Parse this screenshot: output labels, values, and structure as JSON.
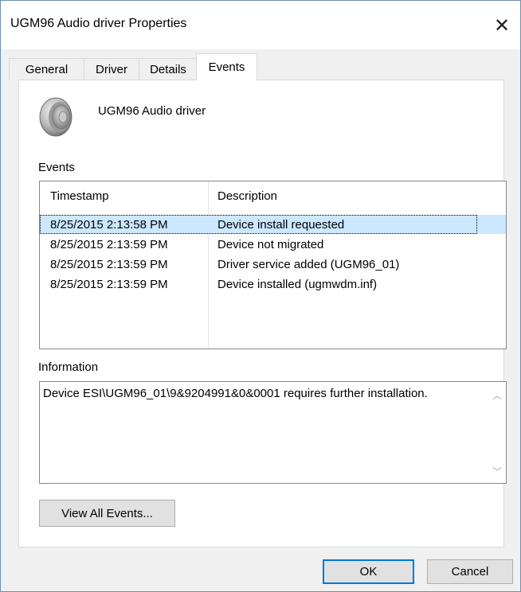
{
  "window": {
    "title": "UGM96 Audio driver Properties",
    "close_glyph": "✕"
  },
  "tabs": [
    {
      "label": "General",
      "active": false
    },
    {
      "label": "Driver",
      "active": false
    },
    {
      "label": "Details",
      "active": false
    },
    {
      "label": "Events",
      "active": true
    }
  ],
  "device": {
    "icon": "speaker-icon",
    "name": "UGM96 Audio driver"
  },
  "events": {
    "section_label": "Events",
    "columns": [
      "Timestamp",
      "Description"
    ],
    "rows": [
      {
        "timestamp": "8/25/2015 2:13:58 PM",
        "description": "Device install requested",
        "selected": true
      },
      {
        "timestamp": "8/25/2015 2:13:59 PM",
        "description": "Device not migrated",
        "selected": false
      },
      {
        "timestamp": "8/25/2015 2:13:59 PM",
        "description": "Driver service added (UGM96_01)",
        "selected": false
      },
      {
        "timestamp": "8/25/2015 2:13:59 PM",
        "description": "Device installed (ugmwdm.inf)",
        "selected": false
      }
    ]
  },
  "information": {
    "section_label": "Information",
    "text": "Device ESI\\UGM96_01\\9&9204991&0&0001 requires further installation."
  },
  "buttons": {
    "view_all_events": "View All Events...",
    "ok": "OK",
    "cancel": "Cancel"
  },
  "colors": {
    "selection": "#cce8ff",
    "default_button_border": "#0078d7"
  }
}
